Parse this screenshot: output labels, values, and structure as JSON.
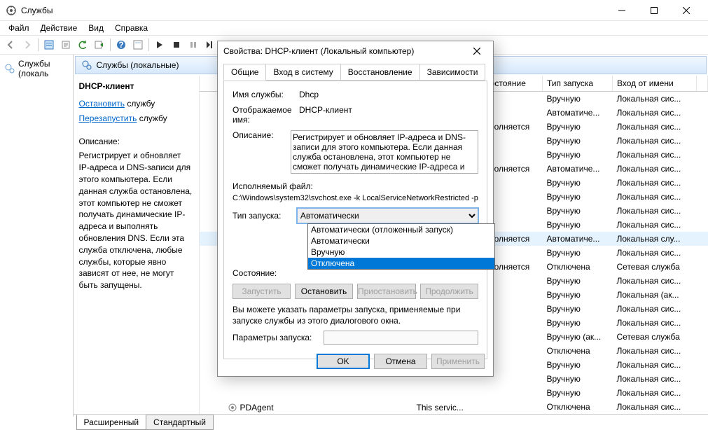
{
  "window": {
    "title": "Службы"
  },
  "menu": {
    "file": "Файл",
    "action": "Действие",
    "view": "Вид",
    "help": "Справка"
  },
  "tree": {
    "root": "Службы (локаль"
  },
  "header": {
    "title": "Службы (локальные)"
  },
  "task": {
    "title": "DHCP-клиент",
    "stop_link": "Остановить",
    "stop_suffix": " службу",
    "restart_link": "Перезапустить",
    "restart_suffix": " службу",
    "desc_label": "Описание:",
    "desc": "Регистрирует и обновляет IP-адреса и DNS-записи для этого компьютера. Если данная служба остановлена, этот компьютер не сможет получать динамические IP-адреса и выполнять обновления DNS. Если эта служба отключена, любые службы, которые явно зависят от нее, не могут быть запущены."
  },
  "columns": {
    "state": "Состояние",
    "startup": "Тип запуска",
    "logon": "Вход от имени"
  },
  "rows": [
    {
      "state": "",
      "startup": "Вручную",
      "logon": "Локальная сис..."
    },
    {
      "state": "",
      "startup": "Автоматиче...",
      "logon": "Локальная сис..."
    },
    {
      "state": "ыполняется",
      "startup": "Вручную",
      "logon": "Локальная сис..."
    },
    {
      "state": "",
      "startup": "Вручную",
      "logon": "Локальная сис..."
    },
    {
      "state": "",
      "startup": "Вручную",
      "logon": "Локальная сис..."
    },
    {
      "state": "ыполняется",
      "startup": "Автоматиче...",
      "logon": "Локальная сис..."
    },
    {
      "state": "",
      "startup": "Вручную",
      "logon": "Локальная сис..."
    },
    {
      "state": "",
      "startup": "Вручную",
      "logon": "Локальная сис..."
    },
    {
      "state": "",
      "startup": "Вручную",
      "logon": "Локальная сис..."
    },
    {
      "state": "",
      "startup": "Вручную",
      "logon": "Локальная сис..."
    },
    {
      "state": "ыполняется",
      "startup": "Автоматиче...",
      "logon": "Локальная слу...",
      "hl": true
    },
    {
      "state": "",
      "startup": "Вручную",
      "logon": "Локальная сис..."
    },
    {
      "state": "ыполняется",
      "startup": "Отключена",
      "logon": "Сетевая служба"
    },
    {
      "state": "",
      "startup": "Вручную",
      "logon": "Локальная сис..."
    },
    {
      "state": "",
      "startup": "Вручную",
      "logon": "Локальная (ак..."
    },
    {
      "state": "",
      "startup": "Вручную",
      "logon": "Локальная сис..."
    },
    {
      "state": "",
      "startup": "Вручную",
      "logon": "Локальная сис..."
    },
    {
      "state": "",
      "startup": "Вручную (ак...",
      "logon": "Сетевая служба"
    },
    {
      "state": "",
      "startup": "Отключена",
      "logon": "Локальная сис..."
    },
    {
      "state": "",
      "startup": "Вручную",
      "logon": "Локальная сис..."
    },
    {
      "state": "",
      "startup": "Вручную",
      "logon": "Локальная сис..."
    },
    {
      "state": "",
      "startup": "Вручную",
      "logon": "Локальная сис..."
    },
    {
      "state": "",
      "startup": "Отключена",
      "logon": "Локальная сис..."
    }
  ],
  "pdagent": {
    "name": "PDAgent",
    "desc": "This servic..."
  },
  "bottom_tabs": {
    "extended": "Расширенный",
    "standard": "Стандартный"
  },
  "dialog": {
    "title": "Свойства: DHCP-клиент (Локальный компьютер)",
    "tabs": {
      "general": "Общие",
      "logon": "Вход в систему",
      "recovery": "Восстановление",
      "deps": "Зависимости"
    },
    "labels": {
      "svc_name": "Имя службы:",
      "display_name": "Отображаемое имя:",
      "description": "Описание:",
      "exe_label": "Исполняемый файл:",
      "startup": "Тип запуска:",
      "state": "Состояние:",
      "hint": "Вы можете указать параметры запуска, применяемые при запуске службы из этого диалогового окна.",
      "params": "Параметры запуска:"
    },
    "values": {
      "svc_name": "Dhcp",
      "display_name": "DHCP-клиент",
      "description": "Регистрирует и обновляет IP-адреса и DNS-записи для этого компьютера. Если данная служба остановлена, этот компьютер не сможет получать динамические IP-адреса и",
      "exe": "C:\\Windows\\system32\\svchost.exe -k LocalServiceNetworkRestricted -p",
      "startup_selected": "Автоматически",
      "state": ""
    },
    "startup_options": [
      "Автоматически (отложенный запуск)",
      "Автоматически",
      "Вручную",
      "Отключена"
    ],
    "dropdown_selected_index": 3,
    "buttons": {
      "start": "Запустить",
      "stop": "Остановить",
      "pause": "Приостановить",
      "resume": "Продолжить"
    },
    "footer": {
      "ok": "OK",
      "cancel": "Отмена",
      "apply": "Применить"
    }
  }
}
